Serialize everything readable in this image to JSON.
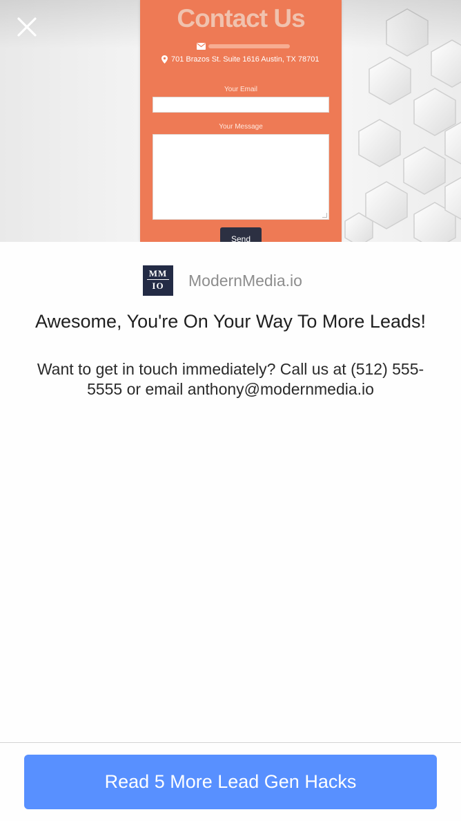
{
  "preview": {
    "form_title": "Contact Us",
    "address": "701 Brazos St. Suite 1616 Austin, TX 78701",
    "email_label": "Your Email",
    "message_label": "Your Message",
    "send_label": "Send",
    "card_color": "#ee7a55"
  },
  "brand": {
    "logo_line1": "MM",
    "logo_line2": "IO",
    "name": "ModernMedia.io"
  },
  "headline": "Awesome, You're On Your Way To More Leads!",
  "body_text": "Want to get in touch immediately? Call us at (512) 555-5555 or email anthony@modernmedia.io",
  "cta": {
    "label": "Read 5 More Lead Gen Hacks",
    "color": "#5890ff"
  },
  "icons": {
    "close": "close-icon",
    "mail": "mail-icon",
    "pin": "map-pin-icon"
  }
}
